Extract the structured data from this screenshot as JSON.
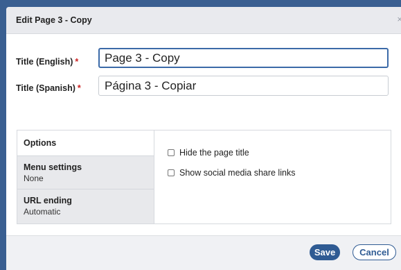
{
  "dialog": {
    "title": "Edit Page 3 - Copy",
    "close_icon": "×"
  },
  "fields": {
    "title_english": {
      "label": "Title (English)",
      "required_mark": "*",
      "value": "Page 3 - Copy"
    },
    "title_spanish": {
      "label": "Title (Spanish)",
      "required_mark": "*",
      "value": "Página 3 - Copiar"
    }
  },
  "options": {
    "nav": [
      {
        "label": "Options",
        "sub": ""
      },
      {
        "label": "Menu settings",
        "sub": "None"
      },
      {
        "label": "URL ending",
        "sub": "Automatic"
      }
    ],
    "checkboxes": [
      {
        "label": "Hide the page title",
        "checked": false
      },
      {
        "label": "Show social media share links",
        "checked": false
      }
    ]
  },
  "footer": {
    "save_label": "Save",
    "cancel_label": "Cancel"
  },
  "colors": {
    "accent": "#2f5b93",
    "required": "#cc2222"
  }
}
